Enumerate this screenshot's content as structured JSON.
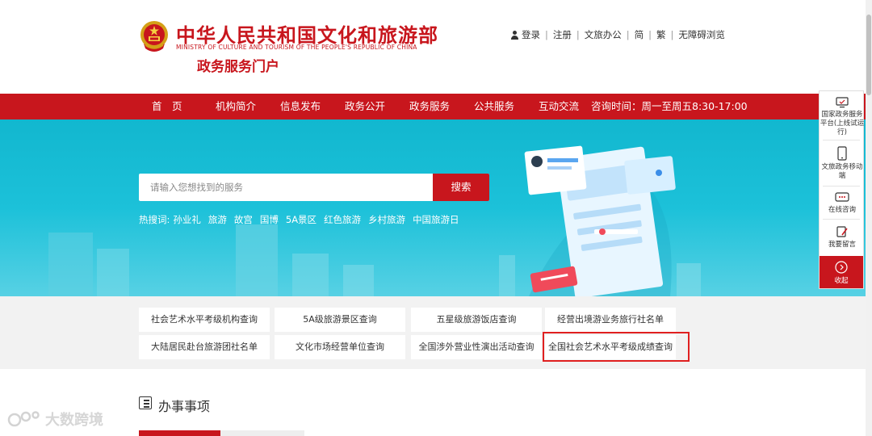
{
  "header": {
    "title": "中华人民共和国文化和旅游部",
    "subtitle": "MINISTRY OF CULTURE AND TOURISM OF THE PEOPLE'S REPUBLIC OF CHINA",
    "portal": "政务服务门户",
    "links": {
      "login": "登录",
      "register": "注册",
      "office": "文旅办公",
      "simplified": "简",
      "traditional": "繁",
      "accessible": "无障碍浏览"
    },
    "separator": "|"
  },
  "nav": {
    "items": [
      "首　页",
      "机构简介",
      "信息发布",
      "政务公开",
      "政务服务",
      "公共服务",
      "互动交流"
    ],
    "hours": "咨询时间：周一至周五8:30-17:00"
  },
  "search": {
    "placeholder": "请输入您想找到的服务",
    "button": "搜索",
    "hot_label": "热搜词:",
    "hot_words": [
      "孙业礼",
      "旅游",
      "故宫",
      "国博",
      "5A景区",
      "红色旅游",
      "乡村旅游",
      "中国旅游日"
    ]
  },
  "float_bar": {
    "items": [
      {
        "label": "国家政务服务平台(上线试运行)",
        "icon": "monitor-icon"
      },
      {
        "label": "文旅政务移动端",
        "icon": "phone-icon"
      },
      {
        "label": "在线咨询",
        "icon": "chat-icon"
      },
      {
        "label": "我要留言",
        "icon": "message-icon"
      }
    ],
    "collapse": "收起",
    "collapse_icon": "chevron-right-icon"
  },
  "quick_links": {
    "row1": [
      "社会艺术水平考级机构查询",
      "5A级旅游景区查询",
      "五星级旅游饭店查询",
      "经营出境游业务旅行社名单"
    ],
    "row2": [
      "大陆居民赴台旅游团社名单",
      "文化市场经营单位查询",
      "全国涉外营业性演出活动查询",
      "全国社会艺术水平考级成绩查询"
    ]
  },
  "section": {
    "title": "办事事项"
  },
  "watermark": "大数跨境",
  "colors": {
    "brand_red": "#c8161d",
    "banner_cyan": "#1cc1d9",
    "highlight": "#e02020"
  }
}
